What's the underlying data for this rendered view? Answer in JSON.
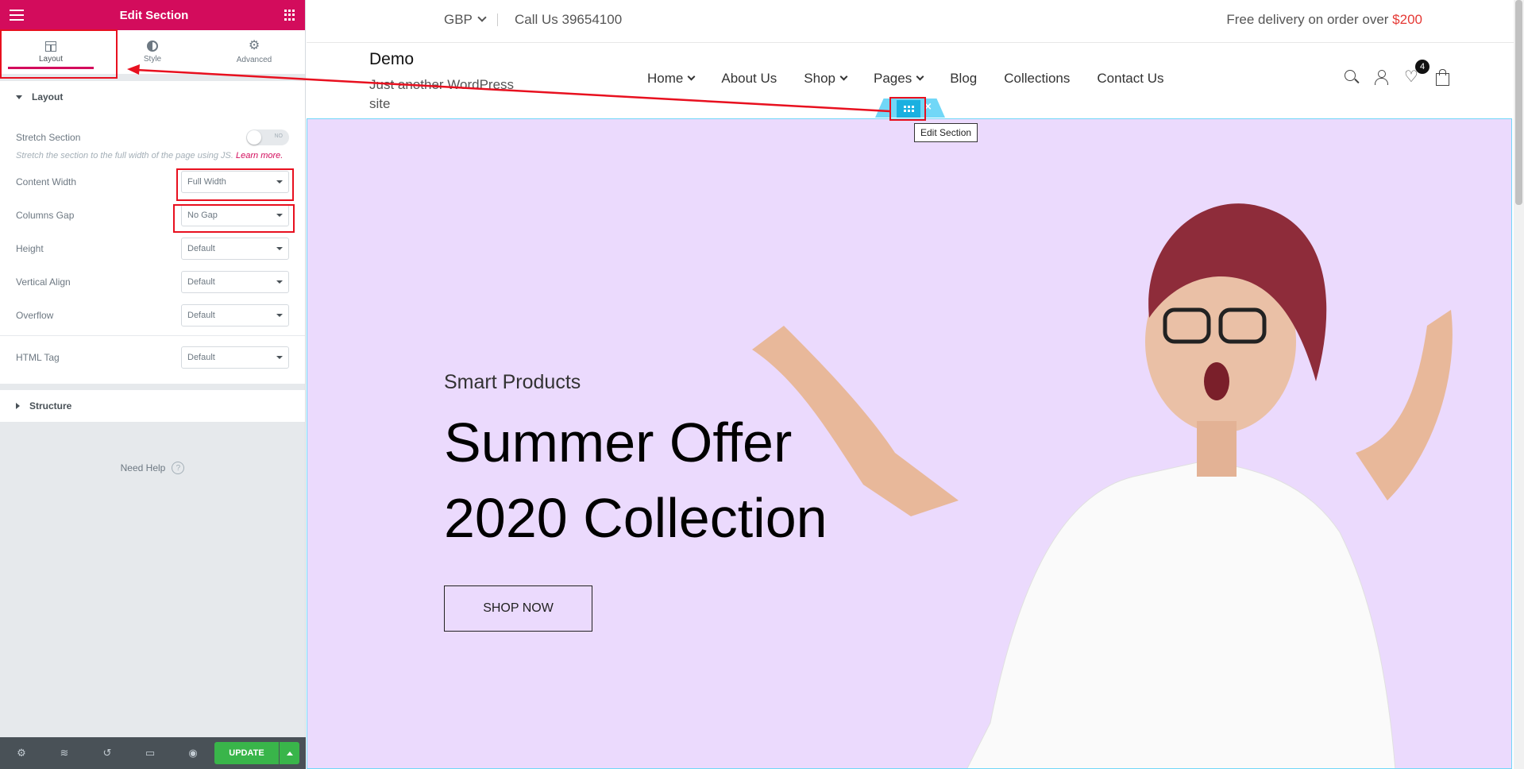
{
  "panel": {
    "title": "Edit Section",
    "tabs": [
      {
        "label": "Layout",
        "icon": "layout-icon",
        "active": true
      },
      {
        "label": "Style",
        "icon": "style-icon"
      },
      {
        "label": "Advanced",
        "icon": "gear-icon"
      }
    ],
    "layout_section": {
      "title": "Layout",
      "stretch_label": "Stretch Section",
      "stretch_toggle": "NO",
      "stretch_desc": "Stretch the section to the full width of the page using JS.",
      "learn_more": "Learn more.",
      "controls": [
        {
          "label": "Content Width",
          "value": "Full Width"
        },
        {
          "label": "Columns Gap",
          "value": "No Gap"
        },
        {
          "label": "Height",
          "value": "Default"
        },
        {
          "label": "Vertical Align",
          "value": "Default"
        },
        {
          "label": "Overflow",
          "value": "Default"
        }
      ],
      "html_tag": {
        "label": "HTML Tag",
        "value": "Default"
      }
    },
    "structure_title": "Structure",
    "need_help": "Need Help",
    "footer": {
      "update": "UPDATE"
    }
  },
  "site": {
    "currency": "GBP",
    "call_us": "Call Us 39654100",
    "delivery_text": "Free delivery on order over ",
    "delivery_amount": "$200",
    "title": "Demo",
    "tagline": "Just another WordPress site",
    "nav": [
      {
        "label": "Home",
        "dropdown": true
      },
      {
        "label": "About Us",
        "dropdown": false
      },
      {
        "label": "Shop",
        "dropdown": true
      },
      {
        "label": "Pages",
        "dropdown": true
      },
      {
        "label": "Blog",
        "dropdown": false
      },
      {
        "label": "Collections",
        "dropdown": false
      },
      {
        "label": "Contact Us",
        "dropdown": false
      }
    ],
    "cart_count": "4",
    "hero": {
      "subtitle": "Smart Products",
      "headline_1": "Summer Offer",
      "headline_2": "2020 Collection",
      "button": "SHOP NOW"
    }
  },
  "editor": {
    "tooltip": "Edit Section"
  },
  "colors": {
    "brand": "#d30c5c",
    "update": "#39b54a",
    "hero_bg": "#ebdafd",
    "annotation": "#e8101f"
  }
}
